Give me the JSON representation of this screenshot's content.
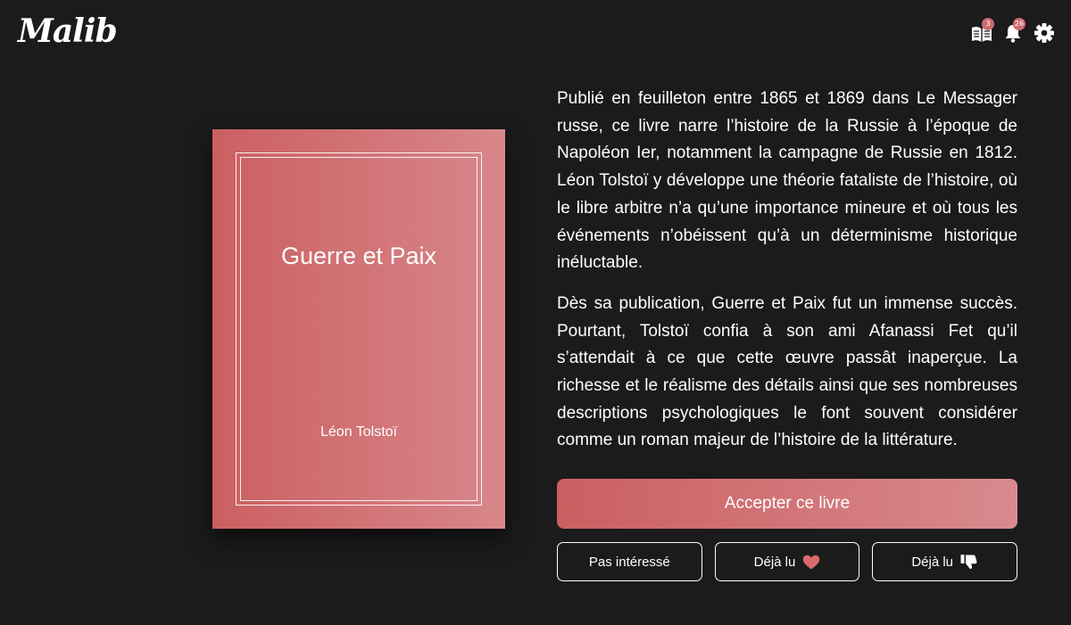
{
  "app": {
    "logo": "Malib"
  },
  "header": {
    "library_badge": "3",
    "notifications_badge": "26",
    "icons": [
      "book-open-icon",
      "bell-icon",
      "gear-icon"
    ]
  },
  "book": {
    "title": "Guerre et Paix",
    "author": "Léon Tolstoï",
    "description": [
      "Publié en feuilleton entre 1865 et 1869 dans Le Messager russe, ce livre narre l’histoire de la Russie à l’époque de Napoléon Ier, notamment la campagne de Russie en 1812. Léon Tolstoï y développe une théorie fataliste de l’histoire, où le libre arbitre n’a qu’une importance mineure et où tous les événements n’obéissent qu’à un déterminisme historique inéluctable.",
      "Dès sa publication, Guerre et Paix fut un immense succès. Pourtant, Tolstoï confia à son ami Afanassi Fet qu’il s’attendait à ce que cette œuvre passât inaperçue. La richesse et le réalisme des détails ainsi que ses nombreuses descriptions psychologiques le font souvent considérer comme un roman majeur de l’histoire de la littérature."
    ]
  },
  "actions": {
    "accept_label": "Accepter ce livre",
    "not_interested_label": "Pas intéressé",
    "read_liked_label": "Déjà lu",
    "read_disliked_label": "Déjà lu"
  },
  "colors": {
    "background": "#1b1b1c",
    "accent_start": "#cb5f61",
    "accent_end": "#d8878b",
    "heart": "#d86a6e"
  }
}
